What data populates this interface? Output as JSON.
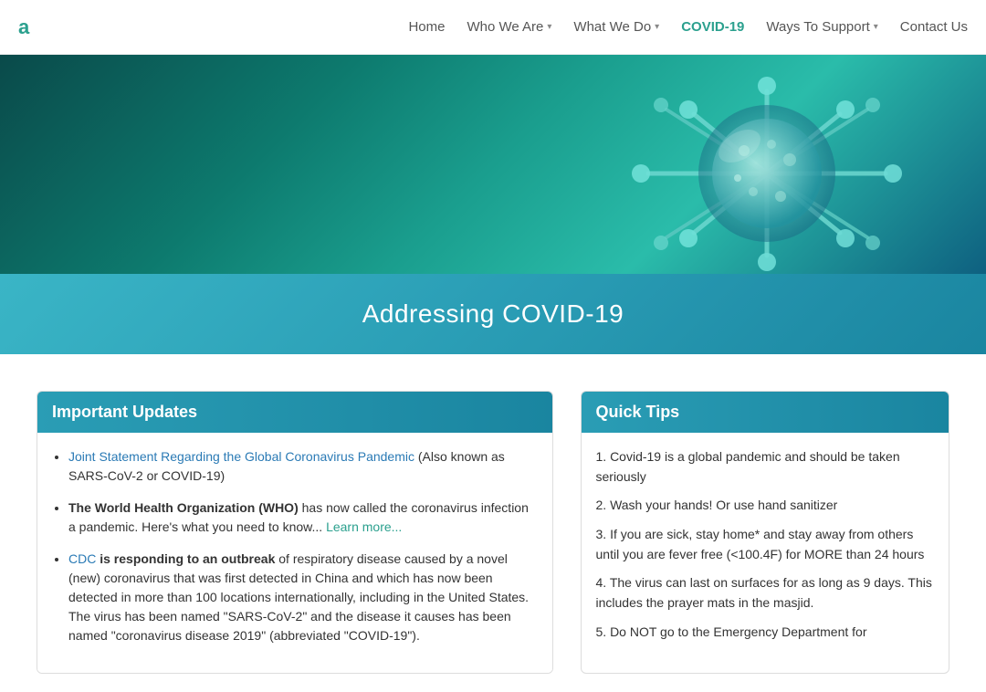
{
  "logo": {
    "text": "a"
  },
  "nav": {
    "links": [
      {
        "id": "home",
        "label": "Home",
        "hasDropdown": false,
        "active": false
      },
      {
        "id": "who-we-are",
        "label": "Who We Are",
        "hasDropdown": true,
        "active": false
      },
      {
        "id": "what-we-do",
        "label": "What We Do",
        "hasDropdown": true,
        "active": false
      },
      {
        "id": "covid-19",
        "label": "COVID-19",
        "hasDropdown": false,
        "active": true
      },
      {
        "id": "ways-to-support",
        "label": "Ways To Support",
        "hasDropdown": true,
        "active": false
      },
      {
        "id": "contact-us",
        "label": "Contact Us",
        "hasDropdown": false,
        "active": false
      }
    ]
  },
  "page": {
    "title": "Addressing COVID-19"
  },
  "important_updates": {
    "header": "Important Updates",
    "items": [
      {
        "link_text": "Joint Statement Regarding the Global Coronavirus Pandemic",
        "rest_text": " (Also known as SARS-CoV-2 or COVID-19)"
      },
      {
        "bold_text": "The World Health Organization (WHO)",
        "rest_text": " has now called the coronavirus infection a pandemic. Here's what you need to know... ",
        "link_text": "Learn more..."
      },
      {
        "link_text": "CDC",
        "bold_text": " is responding to an outbreak",
        "rest_text": " of respiratory disease caused by a novel (new) coronavirus that was first detected in China and which has now been detected in more than 100 locations internationally, including in the United States. The virus has been named \"SARS-CoV-2\" and the disease it causes has been named \"coronavirus disease 2019\" (abbreviated \"COVID-19\")."
      }
    ]
  },
  "quick_tips": {
    "header": "Quick Tips",
    "items": [
      "1. Covid-19 is a global pandemic and should be taken seriously",
      "2. Wash your hands! Or use hand sanitizer",
      "3. If you are sick, stay home* and stay away from others until you are fever free (<100.4F) for MORE than 24 hours",
      "4. The virus can last on surfaces for as long as 9 days. This includes the prayer mats in the masjid.",
      "5. Do NOT go to the Emergency Department for"
    ]
  },
  "colors": {
    "nav_active": "#2ba08e",
    "link_blue": "#2a7ab5",
    "card_header_bg": "#2a9db5"
  }
}
